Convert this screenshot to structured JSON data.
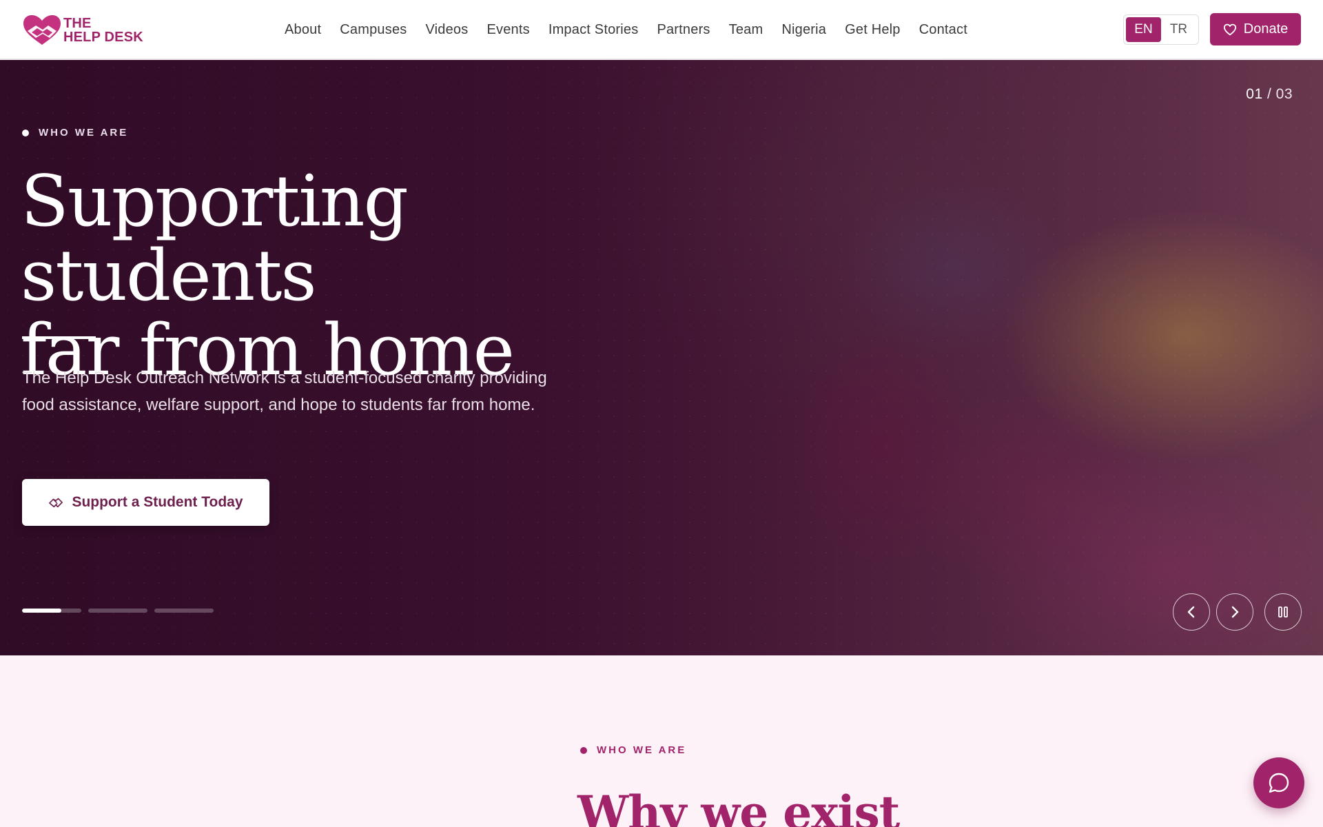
{
  "brand": {
    "line1": "THE",
    "line2": "HELP DESK",
    "color": "#a1246a"
  },
  "nav": {
    "items": [
      {
        "label": "About"
      },
      {
        "label": "Campuses"
      },
      {
        "label": "Videos"
      },
      {
        "label": "Events"
      },
      {
        "label": "Impact Stories"
      },
      {
        "label": "Partners"
      },
      {
        "label": "Team"
      },
      {
        "label": "Nigeria"
      },
      {
        "label": "Get Help"
      },
      {
        "label": "Contact"
      }
    ],
    "languages": [
      {
        "label": "EN",
        "active": true
      },
      {
        "label": "TR",
        "active": false
      }
    ],
    "donate_label": "Donate",
    "donate_icon": "heart-icon"
  },
  "hero": {
    "counter_current": "01",
    "counter_sep": " / ",
    "counter_total": "03",
    "eyebrow": "WHO WE ARE",
    "title_line1": "Supporting students",
    "title_line2": "far from home",
    "body": "The Help Desk Outreach Network is a student-focused charity providing food assistance, welfare support, and hope to students far from home.",
    "cta_label": "Support a Student Today",
    "cta_icon": "handshake-icon",
    "slides_progress": [
      0.66,
      0,
      0
    ],
    "controls": {
      "prev_icon": "chevron-left-icon",
      "next_icon": "chevron-right-icon",
      "pause_icon": "pause-icon"
    }
  },
  "section": {
    "eyebrow": "WHO WE ARE",
    "title": "Why we exist"
  },
  "chat_icon": "chat-bubble-icon"
}
